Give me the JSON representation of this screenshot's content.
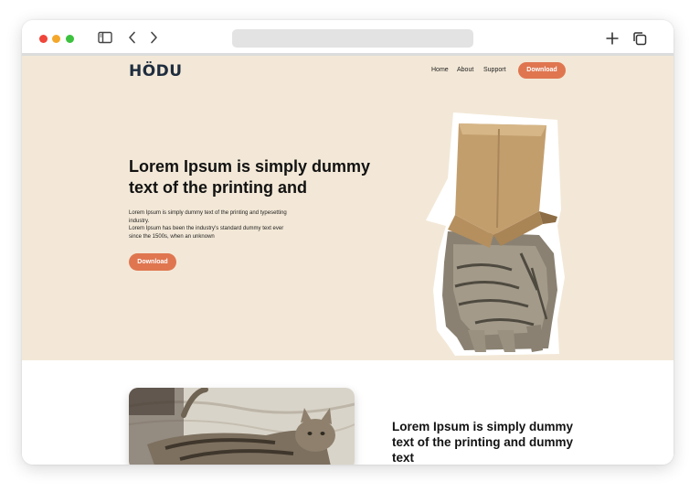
{
  "browser": {
    "traffic_lights": [
      "#f0453a",
      "#f4a82b",
      "#3cc23e"
    ],
    "address_bar_text": ""
  },
  "site": {
    "logo": "HÖDU",
    "nav": {
      "home": "Home",
      "about": "About",
      "support": "Support",
      "download": "Download"
    },
    "hero": {
      "title": "Lorem Ipsum is simply dummy text of the printing and",
      "description": [
        "Lorem Ipsum is simply dummy text of the printing and typesetting industry.",
        "Lorem Ipsum has been the industry's standard dummy text ever since the 1500s, when an unknown"
      ],
      "button": "Download",
      "image": "cat-with-cardboard-box-on-head"
    },
    "section2": {
      "image": "tabby-cat-lying-on-bed",
      "title": "Lorem Ipsum is simply dummy text of the printing and dummy text"
    }
  },
  "colors": {
    "hero_background": "#f3e8d7",
    "accent": "#df7650",
    "logo": "#1e2d3f"
  }
}
